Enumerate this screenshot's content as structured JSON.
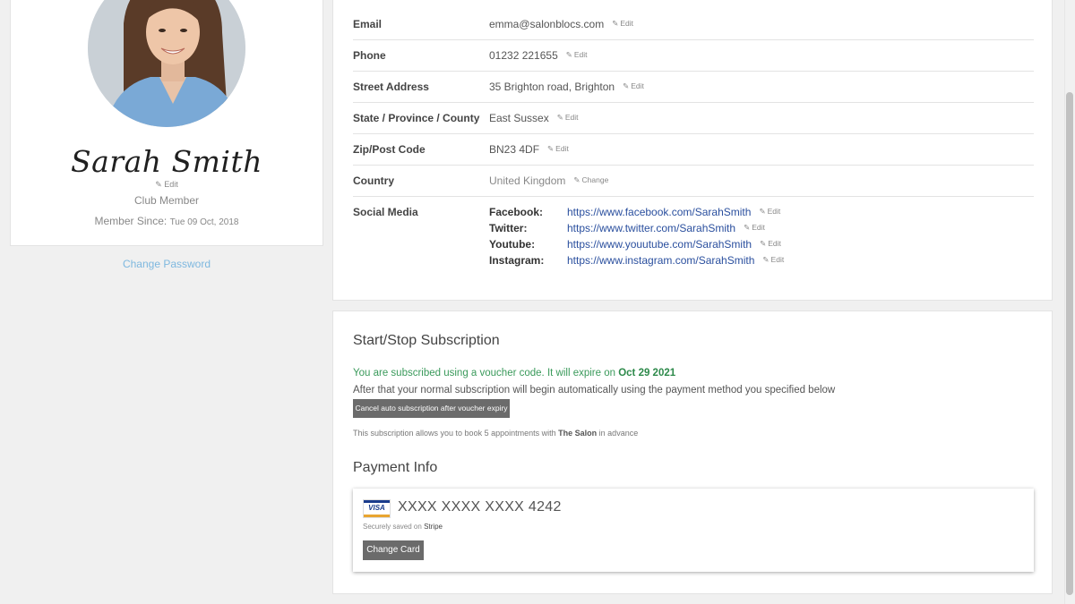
{
  "profile": {
    "name": "Sarah Smith",
    "edit_label": "Edit",
    "member_type": "Club Member",
    "member_since_label": "Member Since:",
    "member_since_date": "Tue 09 Oct, 2018",
    "change_password": "Change Password"
  },
  "details": [
    {
      "label": "Email",
      "value": "emma@salonblocs.com",
      "action": "Edit"
    },
    {
      "label": "Phone",
      "value": "01232 221655",
      "action": "Edit"
    },
    {
      "label": "Street Address",
      "value": "35 Brighton road, Brighton",
      "action": "Edit"
    },
    {
      "label": "State / Province / County",
      "value": "East Sussex",
      "action": "Edit"
    },
    {
      "label": "Zip/Post Code",
      "value": "BN23 4DF",
      "action": "Edit"
    },
    {
      "label": "Country",
      "value": "United Kingdom",
      "action": "Change"
    }
  ],
  "social": {
    "label": "Social Media",
    "items": [
      {
        "name": "Facebook:",
        "url": "https://www.facebook.com/SarahSmith",
        "action": "Edit"
      },
      {
        "name": "Twitter:",
        "url": "https://www.twitter.com/SarahSmith",
        "action": "Edit"
      },
      {
        "name": "Youtube:",
        "url": "https://www.youutube.com/SarahSmith",
        "action": "Edit"
      },
      {
        "name": "Instagram:",
        "url": "https://www.instagram.com/SarahSmith",
        "action": "Edit"
      }
    ]
  },
  "subscription": {
    "title": "Start/Stop Subscription",
    "voucher_text": "You are subscribed using a voucher code. It will expire on",
    "voucher_expiry": "Oct 29 2021",
    "after_text": "After that your normal subscription will begin automatically using the payment method you specified below",
    "cancel_button": "Cancel auto subscription after voucher expiry",
    "allow_prefix": "This subscription allows you to book 5 appointments with",
    "salon_name": "The Salon",
    "allow_suffix": "in advance"
  },
  "payment": {
    "title": "Payment Info",
    "card_brand": "VISA",
    "card_number": "XXXX XXXX XXXX 4242",
    "secure_prefix": "Securely saved on",
    "secure_provider": "Stripe",
    "change_card_button": "Change Card"
  },
  "icons": {
    "edit": "edit-pencil-icon",
    "avatar": "profile-photo"
  },
  "colors": {
    "link": "#2a4f9e",
    "soft_link": "#7eb8df",
    "success": "#3a9a5b",
    "button": "#6b6b6b"
  }
}
